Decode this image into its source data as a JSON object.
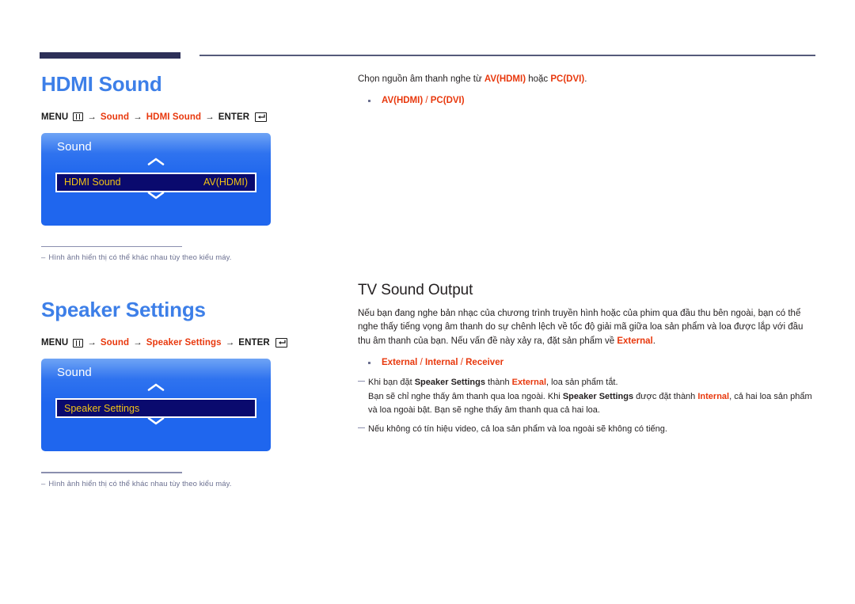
{
  "header": {
    "thick_rule_color": "#2d3058",
    "thin_rule_color": "#555a7a"
  },
  "left_column": {
    "sections": [
      {
        "title": "HDMI Sound",
        "menu_path": {
          "menu_label": "MENU",
          "menu_icon": "menu-grid-icon",
          "arrow": "→",
          "step1": "Sound",
          "step2": "HDMI Sound",
          "enter_label": "ENTER",
          "enter_icon": "enter-return-icon"
        },
        "tv_menu": {
          "panel_title": "Sound",
          "chevron_up_icon": "chevron-up-icon",
          "chevron_down_icon": "chevron-down-icon",
          "row_label": "HDMI Sound",
          "row_value": "AV(HDMI)",
          "row_label_color": "#f2c314",
          "panel_color": "#1f66ee",
          "row_bg_color": "#0a0a6e"
        },
        "footnote": {
          "dash": "–",
          "text": "Hình ảnh hiển thị có thể khác nhau tùy theo kiểu máy."
        }
      },
      {
        "title": "Speaker Settings",
        "menu_path": {
          "menu_label": "MENU",
          "menu_icon": "menu-grid-icon",
          "arrow": "→",
          "step1": "Sound",
          "step2": "Speaker Settings",
          "enter_label": "ENTER",
          "enter_icon": "enter-return-icon"
        },
        "tv_menu": {
          "panel_title": "Sound",
          "chevron_up_icon": "chevron-up-icon",
          "chevron_down_icon": "chevron-down-icon",
          "row_label": "Speaker Settings",
          "row_value": "",
          "row_label_color": "#f2c314",
          "panel_color": "#1f66ee",
          "row_bg_color": "#0a0a6e"
        },
        "footnote": {
          "dash": "–",
          "text": "Hình ảnh hiển thị có thể khác nhau tùy theo kiểu máy."
        }
      }
    ]
  },
  "right_column": {
    "hdmi_sound": {
      "lead_pre": "Chọn nguồn âm thanh nghe từ ",
      "lead_opt1": "AV(HDMI)",
      "lead_mid": " hoặc ",
      "lead_opt2": "PC(DVI)",
      "lead_post": ".",
      "options": "AV(HDMI) / PC(DVI)",
      "option_a": "AV(HDMI)",
      "option_sep": " / ",
      "option_b": "PC(DVI)"
    },
    "tv_sound_output": {
      "title": "TV Sound Output",
      "paragraph_part1": "Nếu bạn đang nghe bản nhạc của chương trình truyền hình hoặc của phim qua đầu thu bên ngoài, bạn có thể nghe thấy tiếng vọng âm thanh do sự chênh lệch về tốc độ giải mã giữa loa sản phẩm và loa được lắp với đầu thu âm thanh của bạn. Nếu vấn đề này xảy ra, đặt sản phẩm về ",
      "paragraph_highlight": "External",
      "paragraph_part2": ".",
      "option_a": "External",
      "option_b": "Internal",
      "option_c": "Receiver",
      "option_sep": " / ",
      "note1_a": "Khi bạn đặt ",
      "note1_b": "Speaker Settings",
      "note1_c": " thành ",
      "note1_d": "External",
      "note1_e": ", loa sản phẩm tắt.",
      "note1_line2_a": "Bạn sẽ chỉ nghe thấy âm thanh qua loa ngoài. Khi ",
      "note1_line2_b": "Speaker Settings",
      "note1_line2_c": " được đặt thành ",
      "note1_line2_d": "Internal",
      "note1_line2_e": ", cả hai loa sản phẩm và loa ngoài bật. Bạn sẽ nghe thấy âm thanh qua cả hai loa.",
      "note2": "Nếu không có tín hiệu video, cả loa sản phẩm và loa ngoài sẽ không có tiếng."
    }
  },
  "colors": {
    "heading_blue": "#3d7fe8",
    "accent_red": "#e8380d",
    "menu_yellow": "#f2c314",
    "footnote_gray": "#6c7191"
  }
}
